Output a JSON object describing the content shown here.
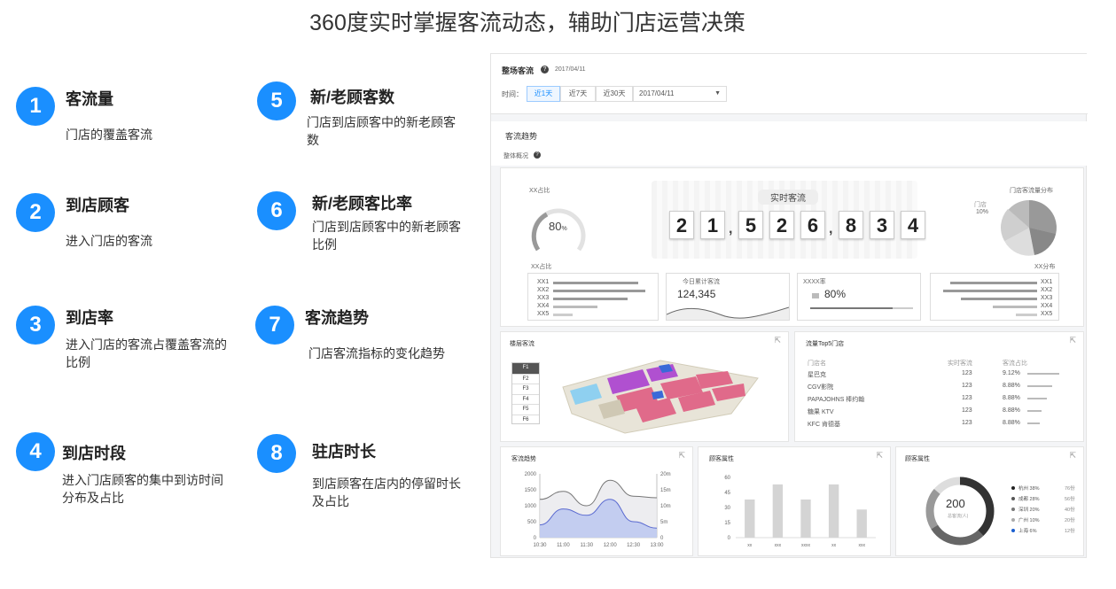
{
  "page_title": "360度实时掌握客流动态，辅助门店运营决策",
  "features": [
    {
      "num": "1",
      "title": "客流量",
      "desc": "门店的覆盖客流"
    },
    {
      "num": "2",
      "title": "到店顾客",
      "desc": "进入门店的客流"
    },
    {
      "num": "3",
      "title": "到店率",
      "desc": "进入门店的客流占覆盖客流的比例"
    },
    {
      "num": "4",
      "title": "到店时段",
      "desc": "进入门店顾客的集中到访时间分布及占比"
    },
    {
      "num": "5",
      "title": "新/老顾客数",
      "desc": "门店到店顾客中的新老顾客数"
    },
    {
      "num": "6",
      "title": "新/老顾客比率",
      "desc": "门店到店顾客中的新老顾客比例"
    },
    {
      "num": "7",
      "title": "客流趋势",
      "desc": "门店客流指标的变化趋势"
    },
    {
      "num": "8",
      "title": "驻店时长",
      "desc": "到店顾客在店内的停留时长及占比"
    }
  ],
  "dashboard": {
    "header_title": "整场客流",
    "header_date": "2017/04/11",
    "time_label": "时间：",
    "time_buttons": [
      "近1天",
      "近7天",
      "近30天"
    ],
    "date_select": "2017/04/11",
    "section_title": "客流趋势",
    "overview_label": "整体概况",
    "gauge_title": "XX占比",
    "gauge_value": "80",
    "gauge_unit": "%",
    "realtime_title": "实时客流",
    "realtime_digits": [
      "2",
      "1",
      "5",
      "2",
      "6",
      "8",
      "3",
      "4"
    ],
    "pie_title": "门店客流量分布",
    "pie_label": "门店",
    "pie_pct": "10%",
    "left_bars_title": "XX占比",
    "left_bars_labels": [
      "XX1",
      "XX2",
      "XX3",
      "XX4",
      "XX5"
    ],
    "right_bars_title": "XX分布",
    "right_bars_labels": [
      "XX1",
      "XX2",
      "XX3",
      "XX4",
      "XX5"
    ],
    "today_title": "今日累计客流",
    "today_value": "124,345",
    "rate_title": "XXXX率",
    "rate_value": "80%",
    "floor_title": "楼层客流",
    "floors": [
      "F1",
      "F2",
      "F3",
      "F4",
      "F5",
      "F6"
    ],
    "top5_title": "流量Top5门店",
    "top5_headers": [
      "门店名",
      "实时客流",
      "客流占比"
    ],
    "top5_rows": [
      {
        "name": "星巴克",
        "count": "123",
        "pct": "9.12%"
      },
      {
        "name": "CGV影院",
        "count": "123",
        "pct": "8.88%"
      },
      {
        "name": "PAPAJOHNS 棒约翰",
        "count": "123",
        "pct": "8.88%"
      },
      {
        "name": "糖果 KTV",
        "count": "123",
        "pct": "8.88%"
      },
      {
        "name": "KFC 肯德基",
        "count": "123",
        "pct": "8.88%"
      }
    ],
    "trend_title": "客流趋势",
    "attr1_title": "顾客属性",
    "attr2_title": "顾客属性",
    "donut_value": "200",
    "donut_sub": "总客流(人)",
    "donut_legend": [
      {
        "label": "杭州 38%",
        "val": "76份",
        "color": "#222222"
      },
      {
        "label": "成都 28%",
        "val": "56份",
        "color": "#555555"
      },
      {
        "label": "深圳 20%",
        "val": "40份",
        "color": "#777777"
      },
      {
        "label": "广州 10%",
        "val": "20份",
        "color": "#aaaaaa"
      },
      {
        "label": "上海 6%",
        "val": "12份",
        "color": "#1a5fd0"
      }
    ]
  },
  "chart_data": [
    {
      "type": "line",
      "title": "客流趋势",
      "x": [
        "10:30",
        "11:00",
        "11:30",
        "12:00",
        "12:30",
        "13:00"
      ],
      "yticks_left": [
        "2000",
        "1500",
        "1000",
        "500",
        "0"
      ],
      "yticks_right": [
        "20m",
        "15m",
        "10m",
        "5m",
        "0"
      ],
      "ylim": [
        0,
        2000
      ],
      "series": [
        {
          "values": [
            1200,
            1450,
            1000,
            1800,
            1300,
            1250
          ]
        },
        {
          "values": [
            400,
            900,
            700,
            1200,
            500,
            300
          ]
        }
      ]
    },
    {
      "type": "bar",
      "title": "顾客属性",
      "categories": [
        "xx",
        "xxx",
        "xxxx",
        "xx",
        "xxx"
      ],
      "values": [
        38,
        53,
        38,
        53,
        28
      ],
      "yticks": [
        "60",
        "45",
        "30",
        "15",
        "0"
      ],
      "ylim": [
        0,
        60
      ]
    }
  ]
}
